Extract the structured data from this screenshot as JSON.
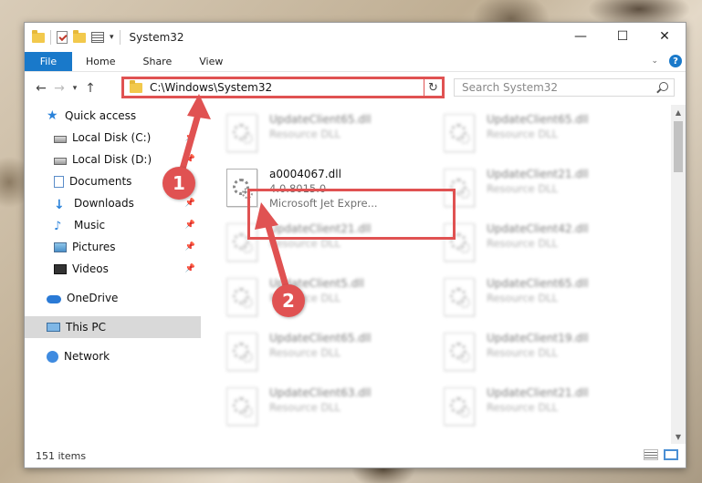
{
  "window": {
    "title": "System32",
    "icons": [
      "folder-icon",
      "properties-check-icon",
      "new-folder-icon",
      "properties-list-icon"
    ]
  },
  "controls": {
    "minimize": "—",
    "maximize": "☐",
    "close": "✕"
  },
  "ribbon": {
    "file": "File",
    "tabs": [
      "Home",
      "Share",
      "View"
    ],
    "help": "?"
  },
  "navigation": {
    "address": "C:\\Windows\\System32",
    "search_placeholder": "Search System32"
  },
  "sidebar": {
    "items": [
      {
        "label": "Quick access",
        "icon": "star-icon"
      },
      {
        "label": "Local Disk (C:)",
        "icon": "drive-icon",
        "pinned": true
      },
      {
        "label": "Local Disk (D:)",
        "icon": "drive-icon",
        "pinned": true
      },
      {
        "label": "Documents",
        "icon": "documents-icon",
        "pinned": true
      },
      {
        "label": "Downloads",
        "icon": "downloads-icon",
        "pinned": true
      },
      {
        "label": "Music",
        "icon": "music-icon",
        "pinned": true
      },
      {
        "label": "Pictures",
        "icon": "pictures-icon",
        "pinned": true
      },
      {
        "label": "Videos",
        "icon": "videos-icon",
        "pinned": true
      },
      {
        "label": "OneDrive",
        "icon": "onedrive-icon"
      },
      {
        "label": "This PC",
        "icon": "this-pc-icon",
        "selected": true
      },
      {
        "label": "Network",
        "icon": "network-icon"
      }
    ]
  },
  "files": {
    "left": [
      {
        "name": "UpdateClient65.dll",
        "sub": "Resource DLL"
      },
      {
        "name": "a0004067.dll",
        "sub": "4.0.8015.0",
        "sub2": "Microsoft Jet Expre...",
        "highlighted": true
      },
      {
        "name": "UpdateClient21.dll",
        "sub": "Resource DLL"
      },
      {
        "name": "UpdateClient5.dll",
        "sub": "Resource DLL"
      },
      {
        "name": "UpdateClient65.dll",
        "sub": "Resource DLL"
      },
      {
        "name": "UpdateClient63.dll",
        "sub": "Resource DLL"
      }
    ],
    "right": [
      {
        "name": "UpdateClient65.dll",
        "sub": "Resource DLL"
      },
      {
        "name": "UpdateClient21.dll",
        "sub": "Resource DLL"
      },
      {
        "name": "UpdateClient42.dll",
        "sub": "Resource DLL"
      },
      {
        "name": "UpdateClient65.dll",
        "sub": "Resource DLL"
      },
      {
        "name": "UpdateClient19.dll",
        "sub": "Resource DLL"
      },
      {
        "name": "UpdateClient21.dll",
        "sub": "Resource DLL"
      }
    ]
  },
  "status": {
    "items": "151 items"
  },
  "callouts": [
    "1",
    "2"
  ],
  "colors": {
    "accent": "#1979ca",
    "annotation": "#e05252"
  }
}
